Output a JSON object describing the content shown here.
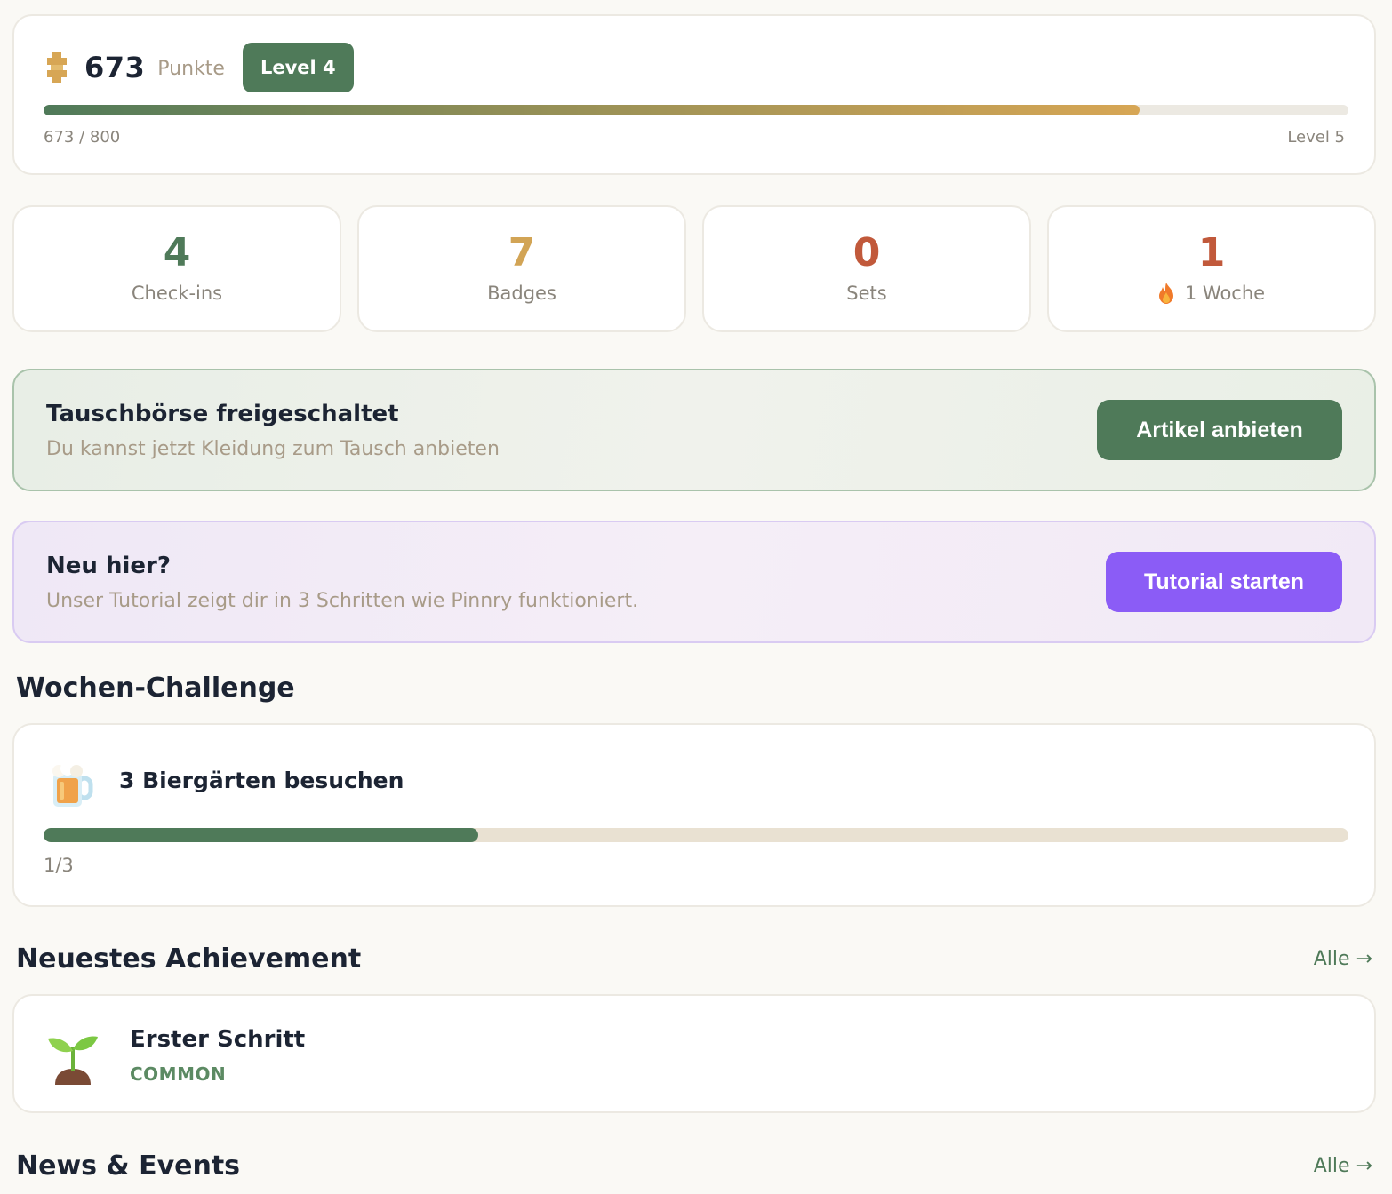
{
  "points": {
    "value": "673",
    "label": "Punkte",
    "level_badge": "Level 4",
    "progress_text": "673 / 800",
    "progress_fraction": 0.84,
    "next_level": "Level 5"
  },
  "stats": [
    {
      "value": "4",
      "label": "Check-ins",
      "color": "#4f7a59"
    },
    {
      "value": "7",
      "label": "Badges",
      "color": "#d2a455"
    },
    {
      "value": "0",
      "label": "Sets",
      "color": "#c1593b"
    },
    {
      "value": "1",
      "label": "1 Woche",
      "color": "#c1593b",
      "icon": "flame-icon"
    }
  ],
  "trade_banner": {
    "title": "Tauschbörse freigeschaltet",
    "subtitle": "Du kannst jetzt Kleidung zum Tausch anbieten",
    "button": "Artikel anbieten"
  },
  "tutorial_banner": {
    "title": "Neu hier?",
    "subtitle": "Unser Tutorial zeigt dir in 3 Schritten wie Pinnry funktioniert.",
    "button": "Tutorial starten"
  },
  "challenge": {
    "section_title": "Wochen-Challenge",
    "icon": "beer-mug-icon",
    "title": "3 Biergärten besuchen",
    "progress_text": "1/3",
    "progress_fraction": 0.333
  },
  "achievement": {
    "section_title": "Neuestes Achievement",
    "link": "Alle →",
    "icon": "sprout-icon",
    "name": "Erster Schritt",
    "rarity": "COMMON"
  },
  "news": {
    "section_title": "News & Events",
    "link": "Alle →"
  },
  "colors": {
    "primary_green": "#4f7a59",
    "gold": "#d2a455",
    "rust": "#c1593b",
    "purple": "#8b5cf6"
  }
}
